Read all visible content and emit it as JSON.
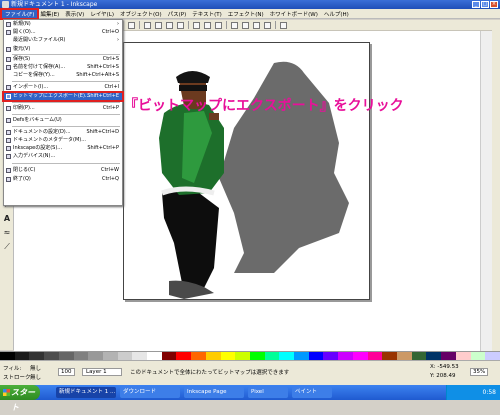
{
  "window": {
    "title": "新規ドキュメント 1 - Inkscape",
    "controls": [
      "_",
      "□",
      "×"
    ]
  },
  "menubar": [
    "ファイル(F)",
    "編集(E)",
    "表示(V)",
    "レイヤ(L)",
    "オブジェクト(O)",
    "パス(P)",
    "テキスト(T)",
    "エフェクト(N)",
    "ホワイトボード(W)",
    "ヘルプ(H)"
  ],
  "file_menu": [
    {
      "label": "新規(N)",
      "shortcut": "",
      "arrow": "›"
    },
    {
      "label": "開く(O)...",
      "shortcut": "Ctrl+O"
    },
    {
      "label": "最近開いたファイル(R)",
      "shortcut": "",
      "arrow": "›"
    },
    {
      "label": "復元(V)",
      "shortcut": ""
    },
    {
      "label": "保存(S)",
      "shortcut": "Ctrl+S"
    },
    {
      "label": "名前を付けて保存(A)...",
      "shortcut": "Shift+Ctrl+S"
    },
    {
      "label": "コピーを保存(Y)...",
      "shortcut": "Shift+Ctrl+Alt+S"
    },
    {
      "label": "インポート(I)...",
      "shortcut": "Ctrl+I"
    },
    {
      "label": "ビットマップにエクスポート(E)...",
      "shortcut": "Shift+Ctrl+E"
    },
    {
      "label": "印刷(P)...",
      "shortcut": "Ctrl+P"
    },
    {
      "label": "Defsをバキューム(U)",
      "shortcut": ""
    },
    {
      "label": "ドキュメントの設定(D)...",
      "shortcut": "Shift+Ctrl+D"
    },
    {
      "label": "ドキュメントのメタデータ(M)...",
      "shortcut": ""
    },
    {
      "label": "Inkscapeの設定(S)...",
      "shortcut": "Shift+Ctrl+P"
    },
    {
      "label": "入力デバイス(N)...",
      "shortcut": ""
    },
    {
      "label": "閉じる(C)",
      "shortcut": "Ctrl+W"
    },
    {
      "label": "終了(Q)",
      "shortcut": "Ctrl+Q"
    }
  ],
  "callout": "『ビットマップにエクスポート』をクリック",
  "status": {
    "fill_label": "フィル:",
    "stroke_label": "ストローク:",
    "fill_value": "無し",
    "stroke_value": "無し",
    "opacity_value": "100",
    "layer": "Layer 1",
    "message": "このドキュメントで全体にわたってビットマップは選択できます",
    "x_coord": "X: -549.53",
    "y_coord": "Y: 208.49",
    "zoom": "35%"
  },
  "taskbar": {
    "start": "スタート",
    "items": [
      "新規ドキュメント 1 ...",
      "ダウンロード",
      "Inkscape Page",
      "Pixel",
      "ペイント"
    ],
    "clock": "0:58"
  },
  "palette": [
    "#000000",
    "#1a1a1a",
    "#333333",
    "#4d4d4d",
    "#666666",
    "#808080",
    "#999999",
    "#b3b3b3",
    "#cccccc",
    "#e6e6e6",
    "#ffffff",
    "#800000",
    "#ff0000",
    "#ff6600",
    "#ffcc00",
    "#ffff00",
    "#ccff00",
    "#00ff00",
    "#00ff99",
    "#00ffff",
    "#0099ff",
    "#0000ff",
    "#6600ff",
    "#cc00ff",
    "#ff00ff",
    "#ff0099",
    "#993300",
    "#cc9966",
    "#336633",
    "#003366",
    "#660066",
    "#ffcccc",
    "#ccffcc",
    "#ccccff"
  ],
  "accent": "#e8109a"
}
